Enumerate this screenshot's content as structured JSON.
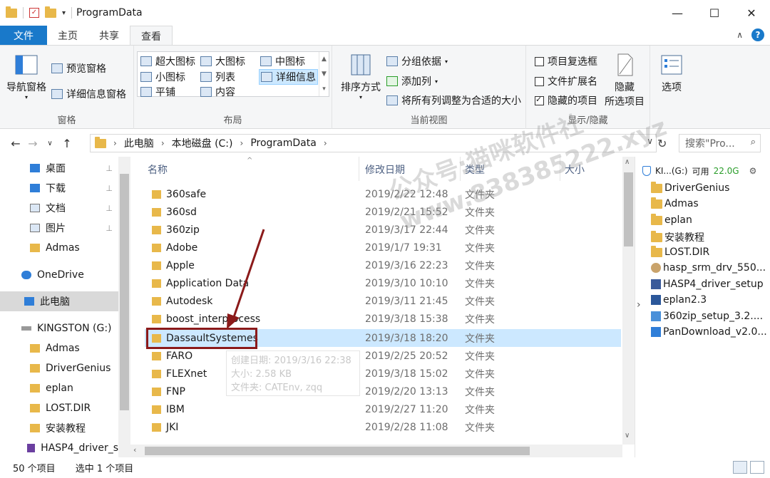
{
  "window": {
    "title": "ProgramData"
  },
  "ribbon_tabs": [
    {
      "label": "文件"
    },
    {
      "label": "主页"
    },
    {
      "label": "共享"
    },
    {
      "label": "查看"
    }
  ],
  "ribbon": {
    "pane_group": {
      "nav_pane": "导航窗格",
      "preview_pane": "预览窗格",
      "details_pane": "详细信息窗格",
      "label": "窗格"
    },
    "layout_group": {
      "items": [
        "超大图标",
        "大图标",
        "中图标",
        "小图标",
        "列表",
        "详细信息",
        "平铺",
        "内容"
      ],
      "selected": "详细信息",
      "label": "布局"
    },
    "current_view_group": {
      "sort_by": "排序方式",
      "group_by": "分组依据",
      "add_columns": "添加列",
      "size_all_columns": "将所有列调整为合适的大小",
      "label": "当前视图"
    },
    "show_hide_group": {
      "item_checkboxes": "项目复选框",
      "file_name_extensions": "文件扩展名",
      "hidden_items": "隐藏的项目",
      "hide_selected_line1": "隐藏",
      "hide_selected_line2": "所选项目",
      "options": "选项",
      "label": "显示/隐藏",
      "item_checkboxes_checked": false,
      "file_name_extensions_checked": false,
      "hidden_items_checked": true
    }
  },
  "address": {
    "crumbs": [
      "此电脑",
      "本地磁盘 (C:)",
      "ProgramData"
    ],
    "search_placeholder": "搜索\"Pro..."
  },
  "nav_pane": {
    "items": [
      {
        "label": "桌面",
        "pinned": true
      },
      {
        "label": "下载",
        "pinned": true
      },
      {
        "label": "文档",
        "pinned": true
      },
      {
        "label": "图片",
        "pinned": true
      },
      {
        "label": "Admas",
        "pinned": false
      },
      {
        "label": "OneDrive",
        "pinned": false
      },
      {
        "label": "此电脑",
        "pinned": false,
        "selected": true
      },
      {
        "label": "KINGSTON (G:)",
        "pinned": false
      },
      {
        "label": "Admas",
        "pinned": false
      },
      {
        "label": "DriverGenius",
        "pinned": false
      },
      {
        "label": "eplan",
        "pinned": false
      },
      {
        "label": "LOST.DIR",
        "pinned": false
      },
      {
        "label": "安装教程",
        "pinned": false
      },
      {
        "label": "HASP4_driver_s",
        "pinned": false
      }
    ]
  },
  "file_list": {
    "columns": [
      "名称",
      "修改日期",
      "类型",
      "大小"
    ],
    "rows": [
      {
        "name": "360safe",
        "date": "2019/2/22 12:48",
        "type": "文件夹"
      },
      {
        "name": "360sd",
        "date": "2019/2/21 15:52",
        "type": "文件夹"
      },
      {
        "name": "360zip",
        "date": "2019/3/17 22:44",
        "type": "文件夹"
      },
      {
        "name": "Adobe",
        "date": "2019/1/7 19:31",
        "type": "文件夹"
      },
      {
        "name": "Apple",
        "date": "2019/3/16 22:23",
        "type": "文件夹"
      },
      {
        "name": "Application Data",
        "date": "2019/3/10 10:10",
        "type": "文件夹"
      },
      {
        "name": "Autodesk",
        "date": "2019/3/11 21:45",
        "type": "文件夹"
      },
      {
        "name": "boost_interprocess",
        "date": "2019/3/18 15:38",
        "type": "文件夹"
      },
      {
        "name": "DassaultSystemes",
        "date": "2019/3/18 18:20",
        "type": "文件夹",
        "selected": true
      },
      {
        "name": "FARO",
        "date": "2019/2/25 20:52",
        "type": "文件夹"
      },
      {
        "name": "FLEXnet",
        "date": "2019/3/18 15:02",
        "type": "文件夹"
      },
      {
        "name": "FNP",
        "date": "2019/2/20 13:13",
        "type": "文件夹"
      },
      {
        "name": "IBM",
        "date": "2019/2/27 11:20",
        "type": "文件夹"
      },
      {
        "name": "JKI",
        "date": "2019/2/28 11:08",
        "type": "文件夹"
      }
    ],
    "tooltip": {
      "created": "创建日期: 2019/3/16 22:38",
      "size": "大小: 2.58 KB",
      "folders": "文件夹: CATEnv, zqq"
    }
  },
  "right_pane": {
    "drive_label": "KI...(G:)",
    "free_label": "可用",
    "free_value": "22.0G",
    "items": [
      "DriverGenius",
      "Admas",
      "eplan",
      "安装教程",
      "LOST.DIR",
      "hasp_srm_drv_550...",
      "HASP4_driver_setup",
      "eplan2.3",
      "360zip_setup_3.2....",
      "PanDownload_v2.0..."
    ]
  },
  "watermark": {
    "line1": "公众号:猫咪软件社",
    "line2": "www.838385222.xyz"
  },
  "status": {
    "count": "50 个项目",
    "selected": "选中 1 个项目"
  },
  "colors": {
    "accent": "#1979ca",
    "selection": "#cce8ff",
    "highlight_box": "#8b1a1a"
  }
}
